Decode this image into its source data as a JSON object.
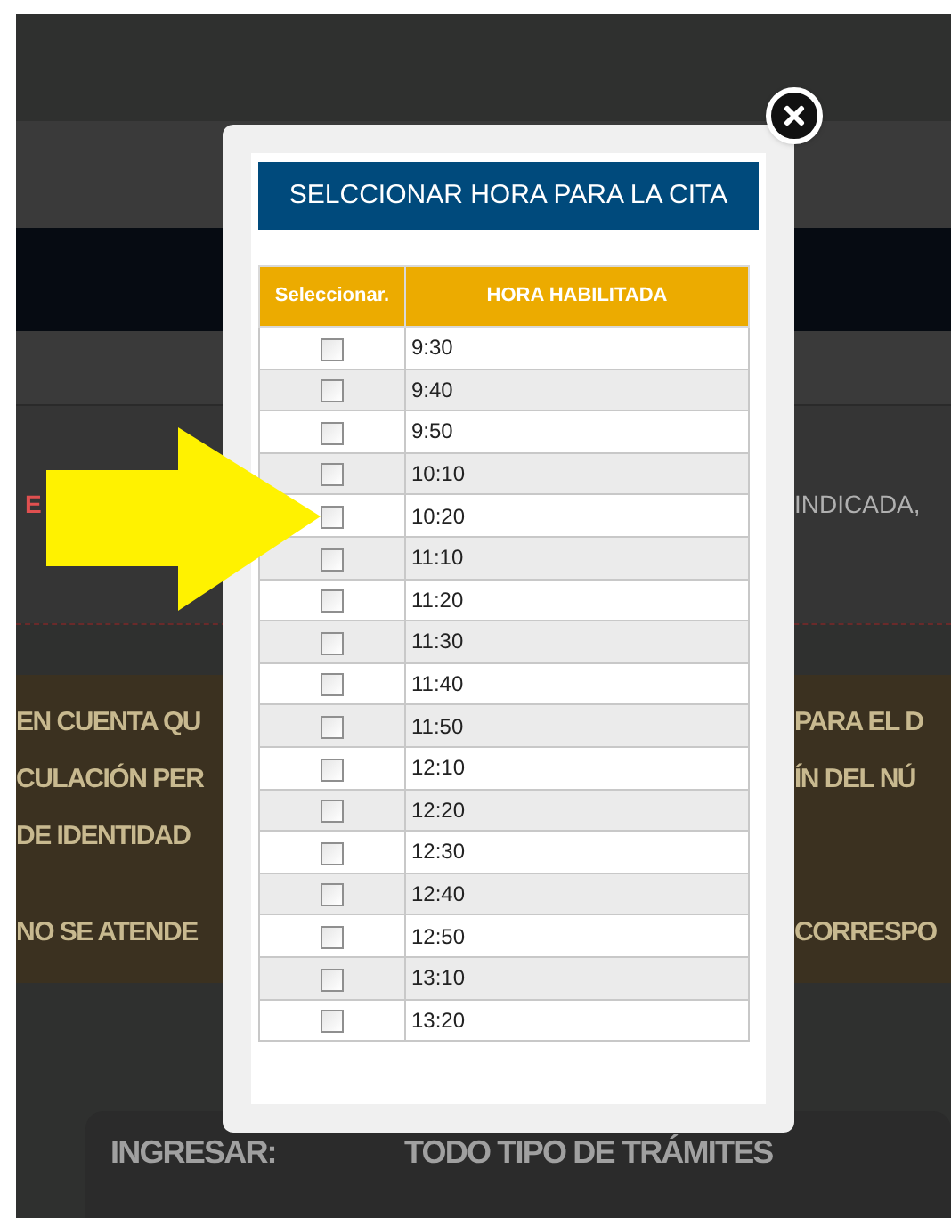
{
  "background": {
    "notice_start": "E",
    "notice_end": "INDICADA, ",
    "warning_lines": [
      {
        "left": "EN CUENTA QU",
        "right": "PARA EL D"
      },
      {
        "left": "CULACIÓN PER",
        "right": "ÍN DEL NÚ"
      },
      {
        "left": "DE IDENTIDAD"
      },
      {
        "left": "NO SE ATENDE",
        "right": "CORRESPO"
      }
    ],
    "info_rows": [
      {
        "label": "INGRESAR:",
        "value": "TODO TIPO DE TRÁMITES"
      }
    ]
  },
  "modal": {
    "title": "SELCCIONAR HORA PARA LA CITA",
    "columns": [
      "Seleccionar.",
      "HORA HABILITADA"
    ],
    "rows": [
      {
        "time": "9:30",
        "checked": false
      },
      {
        "time": "9:40",
        "checked": false
      },
      {
        "time": "9:50",
        "checked": false
      },
      {
        "time": "10:10",
        "checked": false
      },
      {
        "time": "10:20",
        "checked": false
      },
      {
        "time": "11:10",
        "checked": false
      },
      {
        "time": "11:20",
        "checked": false
      },
      {
        "time": "11:30",
        "checked": false
      },
      {
        "time": "11:40",
        "checked": false
      },
      {
        "time": "11:50",
        "checked": false
      },
      {
        "time": "12:10",
        "checked": false
      },
      {
        "time": "12:20",
        "checked": false
      },
      {
        "time": "12:30",
        "checked": false
      },
      {
        "time": "12:40",
        "checked": false
      },
      {
        "time": "12:50",
        "checked": false
      },
      {
        "time": "13:10",
        "checked": false
      },
      {
        "time": "13:20",
        "checked": false
      }
    ]
  }
}
